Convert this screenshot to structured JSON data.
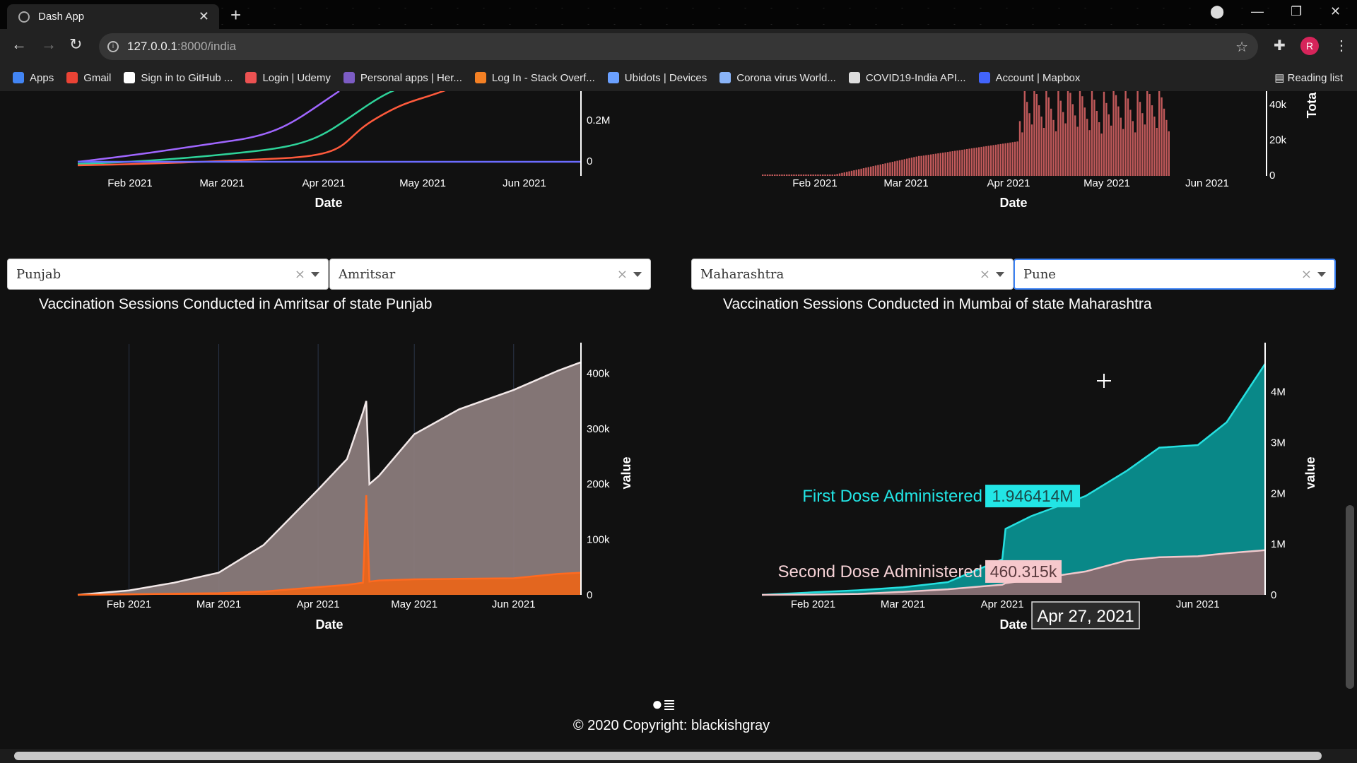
{
  "browser": {
    "tab_title": "Dash App",
    "url_host": "127.0.0.1",
    "url_path": ":8000/india",
    "avatar_letter": "R",
    "bookmarks": [
      {
        "label": "Apps",
        "color": "#4285f4"
      },
      {
        "label": "Gmail",
        "color": "#ea4335"
      },
      {
        "label": "Sign in to GitHub ...",
        "color": "#ffffff"
      },
      {
        "label": "Login | Udemy",
        "color": "#ec5252"
      },
      {
        "label": "Personal apps | Her...",
        "color": "#7c5cc4"
      },
      {
        "label": "Log In - Stack Overf...",
        "color": "#f48024"
      },
      {
        "label": "Ubidots | Devices",
        "color": "#6aa0ff"
      },
      {
        "label": "Corona virus World...",
        "color": "#8ab4f8"
      },
      {
        "label": "COVID19-India API...",
        "color": "#dddddd"
      },
      {
        "label": "Account | Mapbox",
        "color": "#4264fb"
      }
    ],
    "reading_list": "Reading list"
  },
  "top_charts": {
    "left": {
      "xticks": [
        "Feb 2021",
        "Mar 2021",
        "Apr 2021",
        "May 2021",
        "Jun 2021"
      ],
      "yticks": [
        "0.2M",
        "0"
      ],
      "xlabel": "Date"
    },
    "right": {
      "xticks": [
        "Feb 2021",
        "Mar 2021",
        "Apr 2021",
        "May 2021",
        "Jun 2021"
      ],
      "yticks": [
        "40k",
        "20k",
        "0"
      ],
      "xlabel": "Date",
      "ylabel_partial": "Tota"
    }
  },
  "filters": {
    "left_state": "Punjab",
    "left_district": "Amritsar",
    "right_state": "Maharashtra",
    "right_district": "Pune"
  },
  "chart_data": [
    {
      "type": "area",
      "title": "Vaccination Sessions Conducted in Amritsar of state Punjab",
      "xlabel": "Date",
      "ylabel": "value",
      "x": [
        "2021-01-16",
        "2021-02-01",
        "2021-02-15",
        "2021-03-01",
        "2021-03-15",
        "2021-04-01",
        "2021-04-10",
        "2021-04-15",
        "2021-04-16",
        "2021-04-17",
        "2021-04-20",
        "2021-05-01",
        "2021-05-15",
        "2021-06-01",
        "2021-06-15",
        "2021-06-22"
      ],
      "series": [
        {
          "color": "#8a7b7b",
          "values": [
            0,
            8000,
            22000,
            40000,
            90000,
            190000,
            245000,
            330000,
            350000,
            200000,
            215000,
            290000,
            335000,
            370000,
            405000,
            420000
          ]
        },
        {
          "color": "#e8651a",
          "values": [
            0,
            1000,
            2000,
            3000,
            6000,
            14000,
            18000,
            22000,
            180000,
            24000,
            26000,
            28000,
            29000,
            30000,
            38000,
            40000
          ]
        }
      ],
      "ylim": [
        0,
        440000
      ],
      "yticks": [
        "400k",
        "300k",
        "200k",
        "100k",
        "0"
      ],
      "xticks": [
        "Feb 2021",
        "Mar 2021",
        "Apr 2021",
        "May 2021",
        "Jun 2021"
      ]
    },
    {
      "type": "area",
      "title": "Vaccination Sessions Conducted in Mumbai of state Maharashtra",
      "xlabel": "Date",
      "ylabel": "value",
      "x": [
        "2021-01-16",
        "2021-02-01",
        "2021-02-15",
        "2021-03-01",
        "2021-03-15",
        "2021-04-01",
        "2021-04-02",
        "2021-04-10",
        "2021-04-27",
        "2021-05-10",
        "2021-05-20",
        "2021-06-01",
        "2021-06-10",
        "2021-06-22"
      ],
      "series": [
        {
          "name": "First Dose Administered",
          "color": "#0a8f8f",
          "values": [
            0,
            50000,
            90000,
            150000,
            250000,
            700000,
            1300000,
            1550000,
            1946414,
            2450000,
            2900000,
            2950000,
            3400000,
            4550000
          ]
        },
        {
          "name": "Second Dose Administered",
          "color": "#8a6b70",
          "values": [
            0,
            5000,
            20000,
            60000,
            110000,
            200000,
            230000,
            300000,
            460315,
            680000,
            740000,
            760000,
            820000,
            880000
          ]
        }
      ],
      "ylim": [
        0,
        4800000
      ],
      "yticks": [
        "4M",
        "3M",
        "2M",
        "1M",
        "0"
      ],
      "xticks": [
        "Feb 2021",
        "Mar 2021",
        "Apr 2021",
        "Jun 2021"
      ],
      "hover": {
        "date": "Apr 27, 2021",
        "first_dose_label": "First Dose Administered",
        "first_dose_value": "1.946414M",
        "second_dose_label": "Second Dose Administered",
        "second_dose_value": "460.315k"
      }
    }
  ],
  "footer": {
    "copyright": "© 2020 Copyright: blackishgray"
  }
}
